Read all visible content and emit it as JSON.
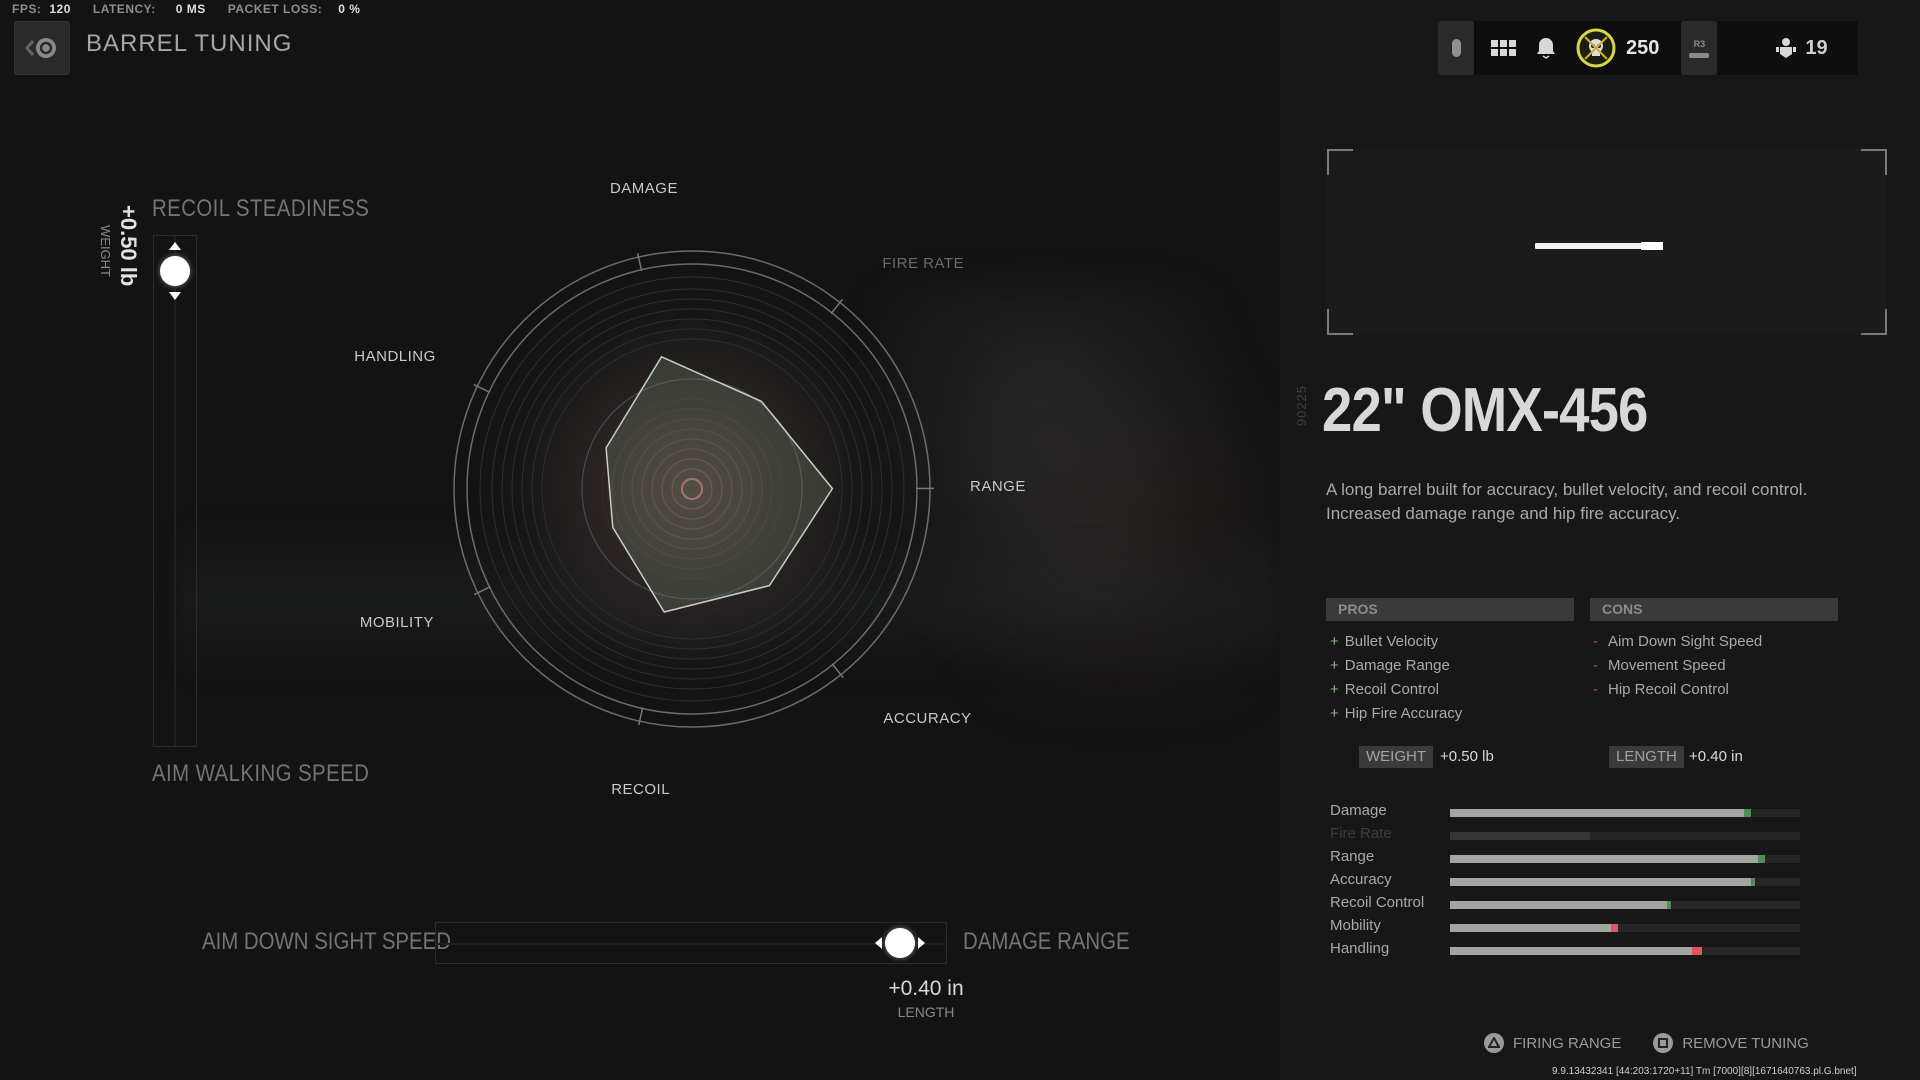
{
  "perf": {
    "fps_label": "FPS:",
    "fps": "120",
    "latency_label": "LATENCY:",
    "latency": "0 MS",
    "packet_loss_label": "PACKET LOSS:",
    "packet_loss": "0 %"
  },
  "header": {
    "title": "BARREL TUNING",
    "currency": "250",
    "party_count": "19",
    "r3_label": "R3"
  },
  "tuning": {
    "vertical": {
      "top_label": "RECOIL STEADINESS",
      "bottom_label": "AIM WALKING SPEED",
      "value_text": "+0.50 lb",
      "value_label": "WEIGHT",
      "position": 1.0
    },
    "horizontal": {
      "left_label": "AIM DOWN SIGHT SPEED",
      "right_label": "DAMAGE RANGE",
      "value_text": "+0.40 in",
      "value_label": "LENGTH",
      "position": 0.96
    }
  },
  "radar": {
    "axes": [
      "DAMAGE",
      "FIRE RATE",
      "RANGE",
      "ACCURACY",
      "RECOIL",
      "MOBILITY",
      "HANDLING"
    ],
    "values": [
      0.57,
      0.47,
      0.59,
      0.52,
      0.53,
      0.37,
      0.4
    ],
    "dim_axes": [
      "FIRE RATE"
    ]
  },
  "attachment": {
    "code": "90225",
    "name": "22\" OMX-456",
    "description": "A long barrel built for accuracy, bullet velocity, and recoil control. Increased damage range and hip fire accuracy.",
    "pros_label": "PROS",
    "cons_label": "CONS",
    "pros": [
      "Bullet Velocity",
      "Damage Range",
      "Recoil Control",
      "Hip Fire Accuracy"
    ],
    "cons": [
      "Aim Down Sight Speed",
      "Movement Speed",
      "Hip Recoil Control"
    ],
    "weight_label": "WEIGHT",
    "weight_value": "+0.50  lb",
    "length_label": "LENGTH",
    "length_value": "+0.40  in"
  },
  "stats": [
    {
      "name": "Damage",
      "base": 0.84,
      "delta": 0.02,
      "dir": "up"
    },
    {
      "name": "Fire Rate",
      "base": 0.4,
      "delta": 0,
      "dir": "none",
      "dim": true
    },
    {
      "name": "Range",
      "base": 0.88,
      "delta": 0.02,
      "dir": "up"
    },
    {
      "name": "Accuracy",
      "base": 0.86,
      "delta": 0.01,
      "dir": "up"
    },
    {
      "name": "Recoil Control",
      "base": 0.62,
      "delta": 0.01,
      "dir": "up"
    },
    {
      "name": "Mobility",
      "base": 0.46,
      "delta": 0.02,
      "dir": "down"
    },
    {
      "name": "Handling",
      "base": 0.69,
      "delta": 0.03,
      "dir": "down"
    }
  ],
  "colors": {
    "positive": "#4f8f5a",
    "negative": "#e0565c",
    "bar": "#a3a6a0"
  },
  "footer": {
    "firing_range": "FIRING RANGE",
    "remove_tuning": "REMOVE TUNING",
    "build": "9.9.13432341 [44:203:1720+11] Tm [7000][8][1671640763.pl.G.bnet]"
  }
}
